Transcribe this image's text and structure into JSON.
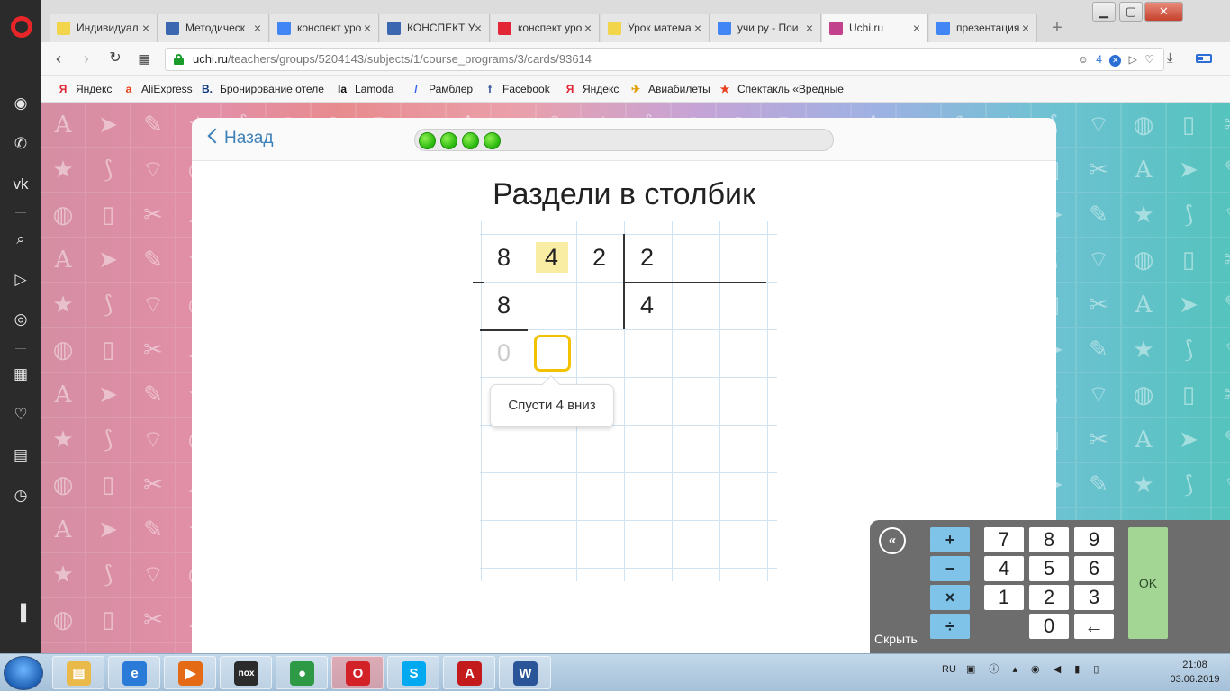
{
  "browser": {
    "tabs": [
      {
        "label": "Индивидуал",
        "icon": "yandex-icon",
        "color": "#f2d54a"
      },
      {
        "label": "Методическ",
        "icon": "m-icon",
        "color": "#3a67b0"
      },
      {
        "label": "конспект уро",
        "icon": "google-icon",
        "color": "#4285f4"
      },
      {
        "label": "КОНСПЕКТ У",
        "icon": "m-icon",
        "color": "#3a67b0"
      },
      {
        "label": "конспект уро",
        "icon": "yandex-icon",
        "color": "#e32636"
      },
      {
        "label": "Урок матема",
        "icon": "yandex-icon",
        "color": "#f2d54a"
      },
      {
        "label": "учи ру - Пои",
        "icon": "google-icon",
        "color": "#4285f4"
      },
      {
        "label": "Uchi.ru",
        "icon": "uchi-icon",
        "color": "#c2418c"
      },
      {
        "label": "презентация",
        "icon": "google-icon",
        "color": "#4285f4"
      }
    ],
    "url": {
      "host": "uchi.ru",
      "path": "/teachers/groups/5204143/subjects/1/course_programs/3/cards/93614"
    },
    "extension_count": "4",
    "bookmarks": [
      {
        "label": "Яндекс",
        "icon": "yandex-icon",
        "glyph": "Я",
        "color": "#e32636"
      },
      {
        "label": "AliExpress",
        "icon": "aliexpress-icon",
        "glyph": "a",
        "color": "#e8431e"
      },
      {
        "label": "Бронирование отеле",
        "icon": "booking-icon",
        "glyph": "B.",
        "color": "#123a80"
      },
      {
        "label": "Lamoda",
        "icon": "lamoda-icon",
        "glyph": "la",
        "color": "#111111"
      },
      {
        "label": "Рамблер",
        "icon": "rambler-icon",
        "glyph": "/",
        "color": "#315efb"
      },
      {
        "label": "Facebook",
        "icon": "facebook-icon",
        "glyph": "f",
        "color": "#3b5998"
      },
      {
        "label": "Яндекс",
        "icon": "yandex-icon",
        "glyph": "Я",
        "color": "#e32636"
      },
      {
        "label": "Авиабилеты",
        "icon": "plane-icon",
        "glyph": "✈",
        "color": "#e0a100"
      },
      {
        "label": "Спектакль «Вредные",
        "icon": "ticket-icon",
        "glyph": "★",
        "color": "#e8431e"
      }
    ]
  },
  "page": {
    "back_label": "Назад",
    "progress_completed": 4,
    "title": "Раздели в столбик",
    "division": {
      "dividend_digits": [
        "8",
        "4",
        "2"
      ],
      "divisor": "2",
      "first_subtrahend": "8",
      "quotient_digits": [
        "4"
      ],
      "remainder_hint": "0"
    },
    "hint": "Спусти 4 вниз"
  },
  "keypad": {
    "collapse_glyph": "«",
    "hide_label": "Скрыть",
    "operators": [
      "+",
      "−",
      "×",
      "÷"
    ],
    "digit_rows": [
      [
        "7",
        "8",
        "9"
      ],
      [
        "4",
        "5",
        "6"
      ],
      [
        "1",
        "2",
        "3"
      ]
    ],
    "zero": "0",
    "backspace": "←",
    "ok": "OK"
  },
  "taskbar": {
    "language": "RU",
    "time": "21:08",
    "date": "03.06.2019",
    "apps": [
      {
        "name": "explorer",
        "glyph": "▤",
        "color": "#e9b949"
      },
      {
        "name": "internet-explorer",
        "glyph": "e",
        "color": "#2a7ad8"
      },
      {
        "name": "media-player",
        "glyph": "▶",
        "color": "#e56a16"
      },
      {
        "name": "nox",
        "glyph": "nox",
        "color": "#2b2b2b"
      },
      {
        "name": "chrome",
        "glyph": "●",
        "color": "#2e9a45"
      },
      {
        "name": "opera",
        "glyph": "O",
        "color": "#d32128"
      },
      {
        "name": "skype",
        "glyph": "S",
        "color": "#00a9f0"
      },
      {
        "name": "acrobat",
        "glyph": "A",
        "color": "#c31b1b"
      },
      {
        "name": "word",
        "glyph": "W",
        "color": "#2a5699"
      }
    ]
  }
}
